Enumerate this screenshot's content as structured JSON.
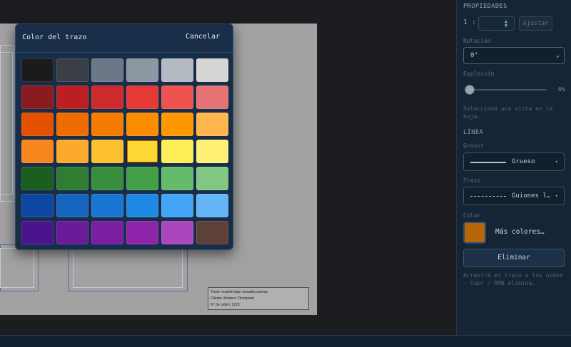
{
  "title_block": {
    "title": "Título: mueble bajo mesada puertas",
    "client": "Cliente: Romero Thompson",
    "order": "N° de orden: 2223"
  },
  "modal": {
    "title": "Color del trazo",
    "cancel": "Cancelar",
    "selected_index": 21,
    "swatches": [
      "#1b1b1d",
      "#3a3f45",
      "#6c7887",
      "#8d97a1",
      "#b3bac2",
      "#d6d6d4",
      "#8a1c20",
      "#ba1f22",
      "#cc2a2c",
      "#e53935",
      "#ef5350",
      "#e57373",
      "#e65100",
      "#ef6c00",
      "#f57c00",
      "#fb8c00",
      "#ff9800",
      "#ffb74d",
      "#f9851e",
      "#fbaa2b",
      "#fdc12d",
      "#fdd835",
      "#ffee58",
      "#fff176",
      "#1b5e20",
      "#2e7d32",
      "#388e3c",
      "#43a047",
      "#66bb6a",
      "#81c784",
      "#0d47a1",
      "#1565c0",
      "#1976d2",
      "#1e88e5",
      "#42a5f5",
      "#64b5f6",
      "#4a148c",
      "#6a1b9a",
      "#7b1fa2",
      "#8e24aa",
      "#ab47bc",
      "#5d4037"
    ]
  },
  "panel": {
    "section_props": "PROPIEDADES",
    "scale_prefix": "1 :",
    "adjust": "Ajustar",
    "rotation_label": "Rotación",
    "rotation_value": "0°",
    "explosion_label": "Explosión",
    "explosion_value": "0%",
    "explosion_fraction": 0,
    "hint_view": "Seleccioná una vista en la hoja.",
    "section_line": "LÍNEA",
    "thickness_label": "Grosor",
    "thickness_value": "Grueso",
    "stroke_label": "Trazo",
    "stroke_value": "Guiones l…",
    "color_label": "Color",
    "color_value": "#b8660a",
    "more_colors": "Más colores…",
    "delete": "Eliminar",
    "hint_drag": "Arrastrá el trazo o los nodos · Supr / RMB elimina."
  }
}
